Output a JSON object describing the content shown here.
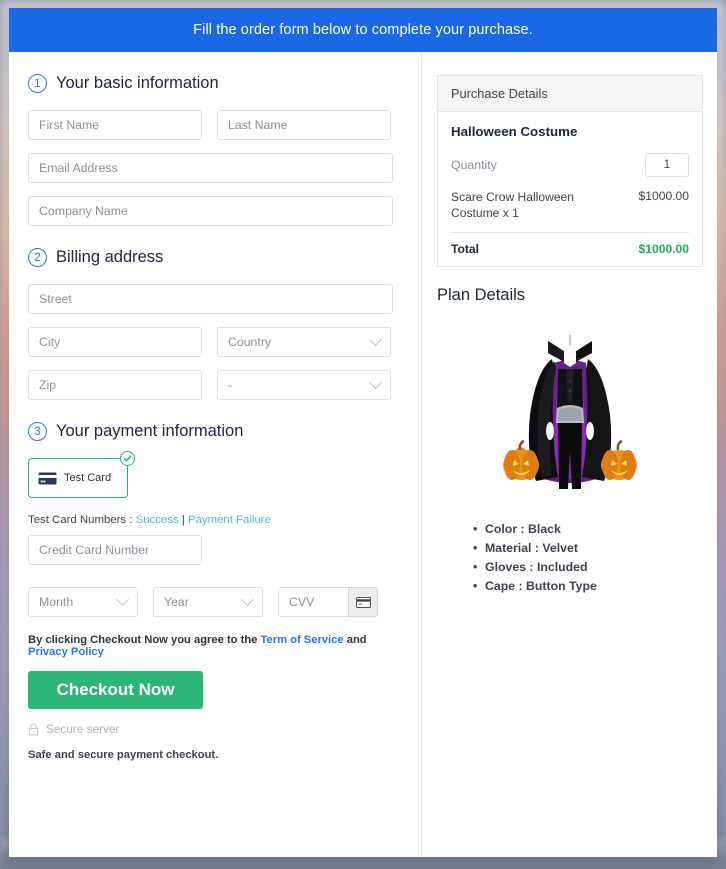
{
  "banner": {
    "text": "Fill the order form below to complete your purchase."
  },
  "steps": {
    "one": {
      "num": "1",
      "title": "Your basic information"
    },
    "two": {
      "num": "2",
      "title": "Billing address"
    },
    "three": {
      "num": "3",
      "title": "Your payment information"
    }
  },
  "basic": {
    "first_name_placeholder": "First Name",
    "last_name_placeholder": "Last Name",
    "email_placeholder": "Email Address",
    "company_placeholder": "Company Name"
  },
  "billing": {
    "street_placeholder": "Street",
    "city_placeholder": "City",
    "country_placeholder": "Country",
    "zip_placeholder": "Zip",
    "state_value": "-"
  },
  "payment": {
    "method_label": "Test Card",
    "test_cards_prefix": "Test Card Numbers : ",
    "success_link": "Success",
    "separator": " | ",
    "failure_link": "Payment Failure",
    "card_number_placeholder": "Credit Card Number",
    "month_placeholder": "Month",
    "year_placeholder": "Year",
    "cvv_placeholder": "CVV"
  },
  "terms": {
    "prefix": "By clicking Checkout Now you agree to the ",
    "tos_link": "Term of Service",
    "middle": " and ",
    "privacy_link": "Privacy Policy"
  },
  "checkout": {
    "button_label": "Checkout Now",
    "secure_label": "Secure server",
    "footnote": "Safe and secure payment checkout."
  },
  "purchase": {
    "header": "Purchase Details",
    "product_title": "Halloween Costume",
    "quantity_label": "Quantity",
    "quantity_value": "1",
    "line_item_name": "Scare Crow Halloween Costume x 1",
    "line_item_amount": "$1000.00",
    "total_label": "Total",
    "total_amount": "$1000.00"
  },
  "plan": {
    "title": "Plan Details",
    "image_name": "halloween-costume-photo",
    "features": [
      "Color : Black",
      "Material : Velvet",
      "Gloves : Included",
      "Cape : Button Type"
    ]
  },
  "colors": {
    "banner_blue": "#1a68e5",
    "accent_green": "#2bb673",
    "total_green": "#1fae55",
    "link_blue": "#2a72e8",
    "link_teal": "#3fc6c6"
  }
}
